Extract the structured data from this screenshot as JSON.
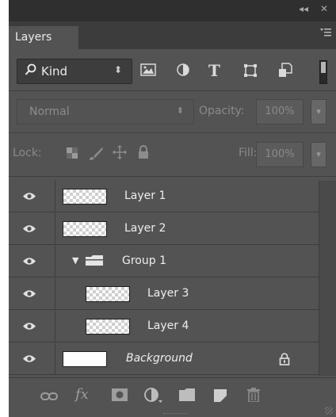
{
  "panel": {
    "title_controls": {
      "collapse": "◂◂",
      "close": "✕"
    },
    "tab_label": "Layers",
    "menu_icon": "panel-menu-icon"
  },
  "filter": {
    "kind_label": "Kind",
    "kind_arrows": "⬍",
    "icons": [
      "image-filter-icon",
      "adjustment-filter-icon",
      "type-filter-icon",
      "shape-filter-icon",
      "smart-object-filter-icon"
    ],
    "type_glyph": "T"
  },
  "blend": {
    "mode": "Normal",
    "opacity_label": "Opacity:",
    "opacity_value": "100%",
    "dropdown_arrow": "▾"
  },
  "lock": {
    "label": "Lock:",
    "icons": [
      "lock-transparent-icon",
      "lock-image-icon",
      "lock-position-icon",
      "lock-all-icon"
    ],
    "fill_label": "Fill:",
    "fill_value": "100%",
    "dropdown_arrow": "▾"
  },
  "layers": [
    {
      "name": "Layer 1",
      "indent": false,
      "type": "layer",
      "visible": true
    },
    {
      "name": "Layer 2",
      "indent": false,
      "type": "layer",
      "visible": true
    },
    {
      "name": "Group 1",
      "indent": false,
      "type": "group",
      "expanded": true,
      "visible": true
    },
    {
      "name": "Layer 3",
      "indent": true,
      "type": "layer",
      "visible": true
    },
    {
      "name": "Layer 4",
      "indent": true,
      "type": "layer",
      "visible": true
    },
    {
      "name": "Background",
      "indent": false,
      "type": "background",
      "locked": true,
      "visible": true
    }
  ],
  "group_expander": "▼",
  "bottom_icons": [
    "link-layers-icon",
    "fx-icon",
    "layer-mask-icon",
    "adjustment-layer-icon",
    "new-group-icon",
    "new-layer-icon",
    "trash-icon"
  ],
  "fx_glyph": "fx",
  "colors": {
    "panel": "#535353",
    "header": "#2f2f2f",
    "divider": "#3d3d3d",
    "text": "#efefef",
    "disabled": "#8a8a8a"
  }
}
